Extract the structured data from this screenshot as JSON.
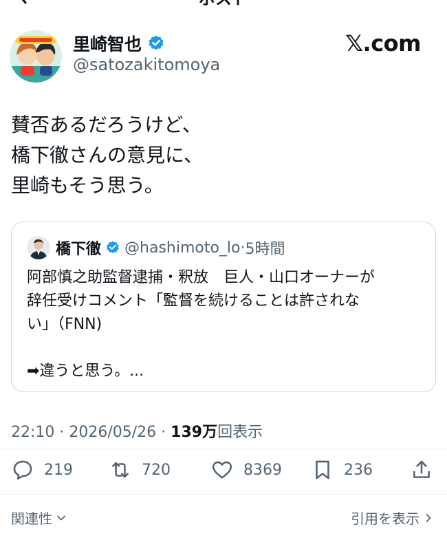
{
  "header": {
    "title": "ポスト",
    "back_icon": "chevron-left-icon"
  },
  "author": {
    "name": "里崎智也",
    "handle": "@satozakitomoya",
    "verified": true,
    "avatar_icon": "illustrated-avatar-icon"
  },
  "site": {
    "label": "𝕏.com"
  },
  "tweet": {
    "lines": [
      "賛否あるだろうけど、",
      "橋下徹さんの意見に、",
      "里崎もそう思う。"
    ]
  },
  "quote": {
    "name": "橋下徹",
    "handle": "@hashimoto_lo",
    "separator": "·",
    "time": "5時間",
    "lines": [
      "阿部慎之助監督逮捕・釈放　巨人・山口オーナーが",
      "辞任受けコメント「監督を続けることは許されな",
      "い」（FNN)",
      "➡違うと思う。..."
    ]
  },
  "meta": {
    "time_date": "22:10 · 2026/05/26 · ",
    "views": "139万",
    "views_label": "回表示"
  },
  "actions": {
    "replies": "219",
    "reposts": "720",
    "likes": "8369",
    "bookmarks": "236"
  },
  "footer": {
    "relevance_label": "関連性",
    "quotes_label": "引用を表示"
  },
  "colors": {
    "text": "#0f1419",
    "muted": "#536471",
    "verified": "#1d9bf0",
    "border": "#cfd9de"
  }
}
